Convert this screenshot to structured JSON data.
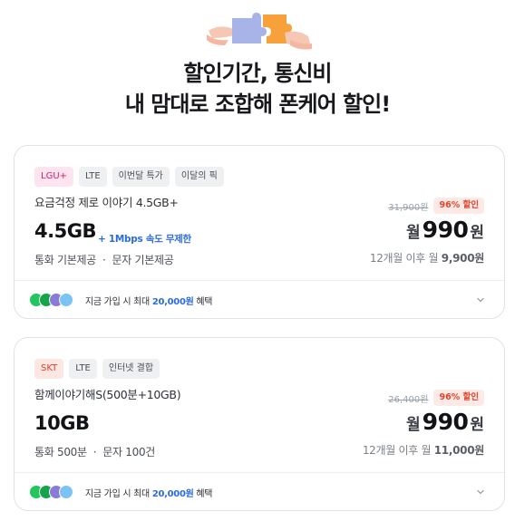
{
  "hero": {
    "title": "할인기간, 통신비",
    "subtitle": "내 맘대로 조합해 폰케어 할인!"
  },
  "plans": [
    {
      "tags": [
        "LGU+",
        "LTE",
        "이번달 특가",
        "이달의 픽"
      ],
      "name": "요금걱정 제로 이야기 4.5GB+",
      "data": "4.5GB",
      "data_extra": "+ 1Mbps 속도 무제한",
      "usage": "통화 기본제공  ·  문자 기본제공",
      "original_price": "31,900원",
      "discount": "96% 할인",
      "price_prefix": "월",
      "price": "990",
      "price_suffix": "원",
      "after_prefix": "12개월 이후 월 ",
      "after_price": "9,900원",
      "benefit_prefix": "지금 가입 시 최대 ",
      "benefit_amount": "20,000원",
      "benefit_suffix": " 혜택"
    },
    {
      "tags": [
        "SKT",
        "LTE",
        "인터넷 결합"
      ],
      "name": "함께이야기해S(500분+10GB)",
      "data": "10GB",
      "data_extra": "",
      "usage": "통화 500분  ·  문자 100건",
      "original_price": "26,400원",
      "discount": "96% 할인",
      "price_prefix": "월",
      "price": "990",
      "price_suffix": "원",
      "after_prefix": "12개월 이후 월 ",
      "after_price": "11,000원",
      "benefit_prefix": "지금 가입 시 최대 ",
      "benefit_amount": "20,000원",
      "benefit_suffix": " 혜택"
    }
  ],
  "colors": {
    "accent_blue": "#2b6be6",
    "discount_red": "#e2432b",
    "logo_colors": [
      "#22c55e",
      "#16a34a",
      "#8b7bd8",
      "#7cc3f5"
    ]
  },
  "icons": {
    "hero": "puzzle-hands-illustration",
    "benefit_logos": "partner-logos",
    "expand": "chevron-down-icon"
  }
}
